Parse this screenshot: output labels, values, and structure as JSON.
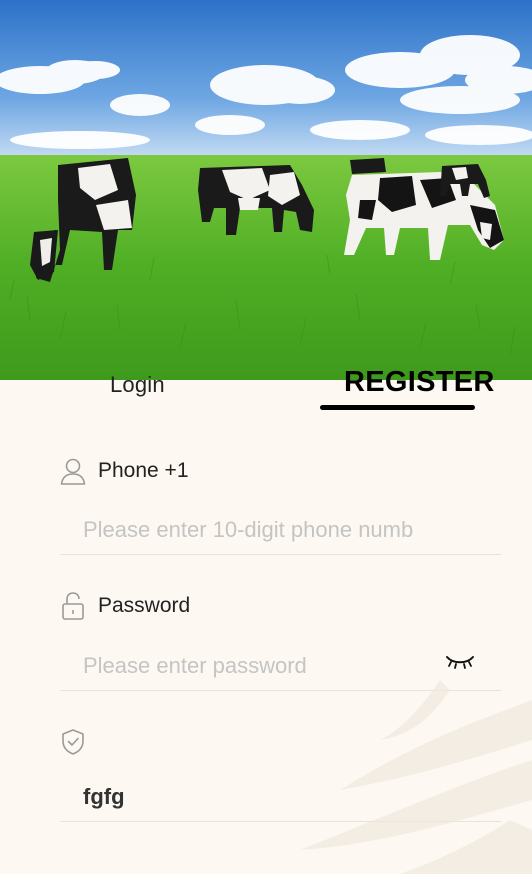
{
  "hero": {
    "image": "cows-grazing-pasture",
    "colors": {
      "sky": "#3f86d9",
      "grass": "#55b82a"
    }
  },
  "tabs": {
    "login_label": "Login",
    "register_label": "REGISTER",
    "active": "register"
  },
  "phone": {
    "icon": "user-icon",
    "label": "Phone +1",
    "placeholder": "Please enter 10-digit phone numb",
    "value": ""
  },
  "password": {
    "icon": "lock-icon",
    "label": "Password",
    "placeholder": "Please enter password",
    "value": "",
    "toggle_icon": "eye-closed-icon"
  },
  "code": {
    "icon": "shield-check-icon",
    "label": "",
    "value": "fgfg"
  }
}
